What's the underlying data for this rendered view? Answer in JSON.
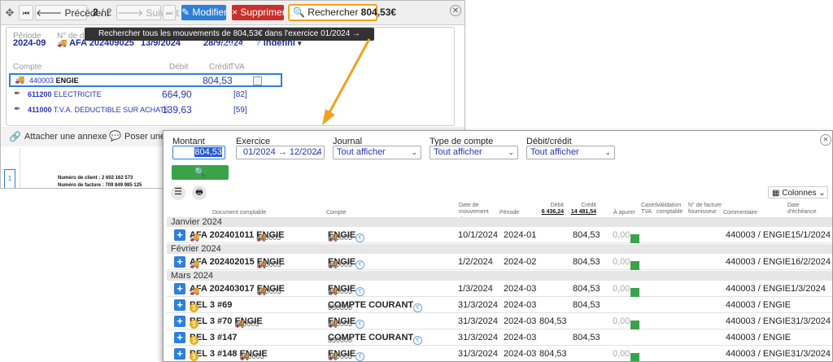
{
  "toolbar": {
    "prev_label": "Précédent",
    "page_current": "2",
    "page_sep": "/ 2",
    "next_label": "Suivant",
    "modifier_label": "Modifier",
    "supprimer_label": "Supprimer",
    "rechercher_prefix": "Rechercher",
    "rechercher_amount": "804,53€"
  },
  "tooltip": "Rechercher tous les mouvements de 804,53€ dans l'exercice 01/2024 → 12/2024",
  "entry": {
    "periode_label": "Période",
    "periode_value": "2024-09",
    "ndoc_label": "N° de do",
    "doc_value": "AFA 202409025",
    "date1": "13/9/2024",
    "date2": "28/9/2024",
    "indefini": "Indéfini",
    "col_compte": "Compte",
    "col_debit": "Débit",
    "col_credit": "Crédit",
    "col_tva": "TVA",
    "lines": [
      {
        "code": "440003",
        "name": "ENGIE",
        "debit": "",
        "credit": "804,53",
        "tva": ""
      },
      {
        "code": "611200",
        "name": "ELECTRICITE",
        "debit": "664,90",
        "credit": "",
        "tva": "[82]"
      },
      {
        "code": "411000",
        "name": "T.V.A. DEDUCTIBLE SUR ACHATS",
        "debit": "139,63",
        "credit": "",
        "tva": "[59]"
      }
    ],
    "attach_label": "Attacher une annexe",
    "poser_label": "Poser une q",
    "doc_page": "1",
    "client_line": "Numéro de client : 2 602 162 573",
    "facture_line": "Numéro de facture : 709 849 985 125"
  },
  "search": {
    "montant_label": "Montant",
    "montant_value": "804,53",
    "exercice_label": "Exercice",
    "exercice_value": "01/2024 → 12/2024",
    "journal_label": "Journal",
    "journal_value": "Tout afficher",
    "type_label": "Type de compte",
    "type_value": "Tout afficher",
    "debitcredit_label": "Débit/crédit",
    "debitcredit_value": "Tout afficher",
    "search_button": "Rechercher",
    "colonnes_label": "Colonnes"
  },
  "table": {
    "headers": {
      "doc": "Document comptable",
      "compte": "Compte",
      "date_mvt": "Date de mouvement",
      "periode": "Période",
      "debit": "Débit",
      "debit_total": "6 436,24",
      "credit": "Crédit",
      "credit_total": "14 481,54",
      "apurer": "À apurer",
      "cases_tva": "Cases TVA",
      "validation": "Validation comptable",
      "nfacture": "N° de facture fournisseur",
      "commentaire": "Commentaire",
      "echeance": "Date d'échéance"
    },
    "groups": [
      {
        "label": "Janvier 2024",
        "rows": [
          {
            "doc": "AFA 202401011",
            "doc_kind": "truck",
            "doc_acct": "440003",
            "doc_acct_name": "ENGIE",
            "compte_code": "440003",
            "compte_name": "ENGIE",
            "compte_kind": "truck",
            "date": "10/1/2024",
            "periode": "2024-01",
            "debit": "",
            "credit": "804,53",
            "apurer": "0,00",
            "comment": "440003 / ENGIE",
            "echeance": "15/1/2024"
          }
        ]
      },
      {
        "label": "Février 2024",
        "rows": [
          {
            "doc": "AFA 202402015",
            "doc_kind": "truck",
            "doc_acct": "440003",
            "doc_acct_name": "ENGIE",
            "compte_code": "440003",
            "compte_name": "ENGIE",
            "compte_kind": "truck",
            "date": "1/2/2024",
            "periode": "2024-02",
            "debit": "",
            "credit": "804,53",
            "apurer": "0,00",
            "comment": "440003 / ENGIE",
            "echeance": "16/2/2024"
          }
        ]
      },
      {
        "label": "Mars 2024",
        "rows": [
          {
            "doc": "AFA 202403017",
            "doc_kind": "truck",
            "doc_acct": "440003",
            "doc_acct_name": "ENGIE",
            "compte_code": "440003",
            "compte_name": "ENGIE",
            "compte_kind": "truck",
            "date": "1/3/2024",
            "periode": "2024-03",
            "debit": "",
            "credit": "804,53",
            "apurer": "0,00",
            "comment": "440003 / ENGIE",
            "echeance": "1/3/2024"
          },
          {
            "doc": "BEL 3 #69",
            "doc_kind": "bank",
            "doc_acct": "",
            "doc_acct_name": "",
            "compte_code": "550000",
            "compte_name": "COMPTE COURANT",
            "compte_kind": "pen",
            "date": "31/3/2024",
            "periode": "2024-03",
            "debit": "",
            "credit": "804,53",
            "apurer": "",
            "comment": "440003 / ENGIE",
            "echeance": ""
          },
          {
            "doc": "BEL 3 #70",
            "doc_kind": "bank",
            "doc_acct": "440003",
            "doc_acct_name": "ENGIE",
            "compte_code": "440003",
            "compte_name": "ENGIE",
            "compte_kind": "truck",
            "date": "31/3/2024",
            "periode": "2024-03",
            "debit": "804,53",
            "credit": "",
            "apurer": "0,00",
            "comment": "440003 / ENGIE",
            "echeance": "31/3/2024"
          },
          {
            "doc": "BEL 3 #147",
            "doc_kind": "bank",
            "doc_acct": "",
            "doc_acct_name": "",
            "compte_code": "550000",
            "compte_name": "COMPTE COURANT",
            "compte_kind": "pen",
            "date": "31/3/2024",
            "periode": "2024-03",
            "debit": "",
            "credit": "804,53",
            "apurer": "",
            "comment": "440003 / ENGIE",
            "echeance": ""
          },
          {
            "doc": "BEL 3 #148",
            "doc_kind": "bank",
            "doc_acct": "440003",
            "doc_acct_name": "ENGIE",
            "compte_code": "440003",
            "compte_name": "ENGIE",
            "compte_kind": "truck",
            "date": "31/3/2024",
            "periode": "2024-03",
            "debit": "804,53",
            "credit": "",
            "apurer": "0,00",
            "comment": "440003 / ENGIE",
            "echeance": "31/3/2024"
          }
        ]
      }
    ]
  },
  "colors": {
    "accent": "#f0a21e",
    "primary": "#2f7fd8",
    "danger": "#c9302c",
    "success": "#3aa34a"
  }
}
